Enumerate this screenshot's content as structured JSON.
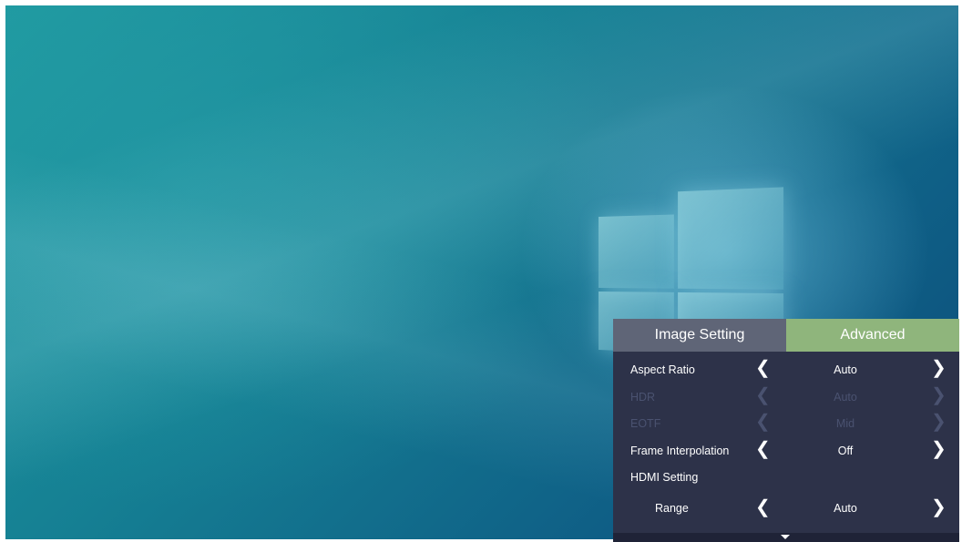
{
  "osd": {
    "tabs": [
      {
        "label": "Image Setting",
        "active": false
      },
      {
        "label": "Advanced",
        "active": true
      }
    ],
    "rows": {
      "aspect_ratio": {
        "label": "Aspect Ratio",
        "value": "Auto"
      },
      "hdr": {
        "label": "HDR",
        "value": "Auto",
        "disabled": true
      },
      "eotf": {
        "label": "EOTF",
        "value": "Mid",
        "disabled": true
      },
      "frame_interpolation": {
        "label": "Frame Interpolation",
        "value": "Off"
      },
      "hdmi_setting": {
        "label": "HDMI Setting"
      },
      "range": {
        "label": "Range",
        "value": "Auto"
      }
    },
    "arrow_left": "❮",
    "arrow_right": "❯"
  },
  "colors": {
    "panel_bg": "#2d3249",
    "tab_inactive": "#5f6577",
    "tab_active": "#8fb57c",
    "disabled_text": "#4a5270"
  },
  "icons": [
    "windows-logo",
    "chevron-left-icon",
    "chevron-right-icon",
    "scroll-down-icon"
  ]
}
